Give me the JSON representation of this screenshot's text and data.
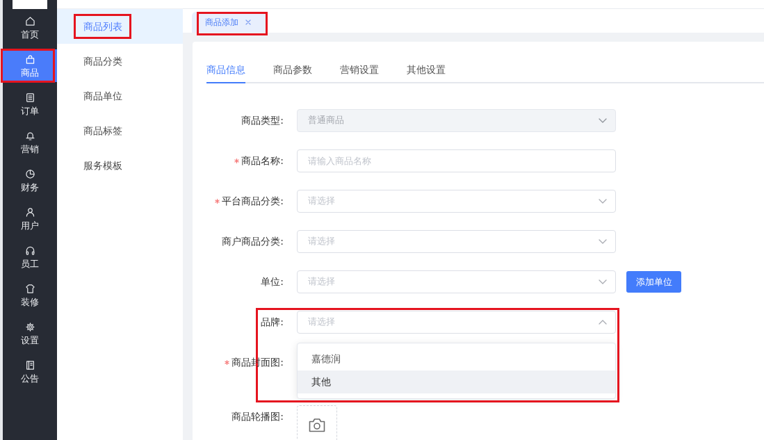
{
  "sidebar": {
    "items": [
      {
        "label": "首页",
        "selected": false,
        "annotated": false
      },
      {
        "label": "商品",
        "selected": true,
        "annotated": true
      },
      {
        "label": "订单",
        "selected": false,
        "annotated": false
      },
      {
        "label": "营销",
        "selected": false,
        "annotated": false
      },
      {
        "label": "财务",
        "selected": false,
        "annotated": false
      },
      {
        "label": "用户",
        "selected": false,
        "annotated": false
      },
      {
        "label": "员工",
        "selected": false,
        "annotated": false
      },
      {
        "label": "装修",
        "selected": false,
        "annotated": false
      },
      {
        "label": "设置",
        "selected": false,
        "annotated": false
      },
      {
        "label": "公告",
        "selected": false,
        "annotated": false
      }
    ]
  },
  "submenu": {
    "items": [
      {
        "label": "商品列表",
        "selected": true,
        "annotated": true
      },
      {
        "label": "商品分类",
        "selected": false,
        "annotated": false
      },
      {
        "label": "商品单位",
        "selected": false,
        "annotated": false
      },
      {
        "label": "商品标签",
        "selected": false,
        "annotated": false
      },
      {
        "label": "服务模板",
        "selected": false,
        "annotated": false
      }
    ]
  },
  "page_tabs": [
    {
      "label": "商品添加",
      "selected": true,
      "closable": true,
      "annotated": true
    }
  ],
  "form_card": {
    "tabs": [
      {
        "label": "商品信息",
        "selected": true
      },
      {
        "label": "商品参数",
        "selected": false
      },
      {
        "label": "营销设置",
        "selected": false
      },
      {
        "label": "其他设置",
        "selected": false
      }
    ],
    "rows": [
      {
        "label": "商品类型:",
        "required": false,
        "kind": "select",
        "value": "普通商品",
        "disabled": true,
        "expanded": false,
        "annotated": false
      },
      {
        "label": "商品名称:",
        "required": true,
        "kind": "input",
        "placeholder": "请输入商品名称",
        "annotated": false
      },
      {
        "label": "平台商品分类:",
        "required": true,
        "kind": "select",
        "placeholder": "请选择",
        "disabled": false,
        "expanded": false,
        "annotated": false
      },
      {
        "label": "商户商品分类:",
        "required": false,
        "kind": "select",
        "placeholder": "请选择",
        "disabled": false,
        "expanded": false,
        "annotated": false
      },
      {
        "label": "单位:",
        "required": false,
        "kind": "select",
        "placeholder": "请选择",
        "disabled": false,
        "expanded": false,
        "button": "添加单位",
        "annotated": false
      },
      {
        "label": "品牌:",
        "required": false,
        "kind": "select",
        "placeholder": "请选择",
        "disabled": false,
        "expanded": true,
        "annotated": true,
        "options": [
          {
            "label": "嘉德润",
            "selected": false,
            "hovered": false
          },
          {
            "label": "其他",
            "selected": false,
            "hovered": true
          }
        ]
      },
      {
        "label": "商品封面图:",
        "required": true,
        "kind": "label",
        "annotated": false
      },
      {
        "label": "商品轮播图:",
        "required": false,
        "kind": "upload",
        "annotated": false
      }
    ]
  }
}
